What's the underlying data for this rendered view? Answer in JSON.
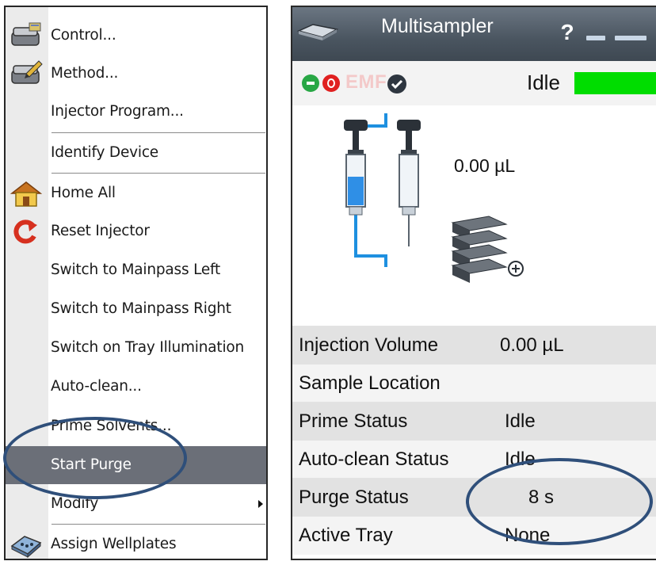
{
  "context_menu": {
    "items": [
      {
        "label": "Control...",
        "icon": "control-device-icon"
      },
      {
        "label": "Method...",
        "icon": "method-edit-icon"
      },
      {
        "label": "Injector Program...",
        "icon": ""
      },
      {
        "label": "Identify Device",
        "icon": ""
      },
      {
        "label": "Home All",
        "icon": "home-icon"
      },
      {
        "label": "Reset Injector",
        "icon": "reset-arrow-icon"
      },
      {
        "label": "Switch  to Mainpass Left",
        "icon": ""
      },
      {
        "label": "Switch to Mainpass Right",
        "icon": ""
      },
      {
        "label": "Switch on Tray Illumination",
        "icon": ""
      },
      {
        "label": "Auto-clean...",
        "icon": ""
      },
      {
        "label": "Prime Solvents...",
        "icon": ""
      },
      {
        "label": "Start Purge",
        "icon": "",
        "highlighted": true
      },
      {
        "label": "Modify",
        "icon": "",
        "has_submenu": true
      },
      {
        "label": "Assign Wellplates",
        "icon": "wellplate-icon"
      }
    ]
  },
  "panel": {
    "title": "Multisampler",
    "help_label": "?",
    "status": {
      "emf_label": "EMF",
      "state": "Idle",
      "state_color": "#00dd00"
    },
    "volume_display": "0.00 µL",
    "properties": [
      {
        "name": "Injection Volume",
        "value": "0.00 µL"
      },
      {
        "name": "Sample Location",
        "value": ""
      },
      {
        "name": "Prime Status",
        "value": "Idle"
      },
      {
        "name": "Auto-clean Status",
        "value": "Idle"
      },
      {
        "name": "Purge Status",
        "value": "8 s"
      },
      {
        "name": "Active Tray",
        "value": "None"
      }
    ]
  },
  "colors": {
    "menu_highlight": "#6b6f78",
    "annotation_ellipse": "#2f4f7a",
    "titlebar": "#4a5560"
  }
}
